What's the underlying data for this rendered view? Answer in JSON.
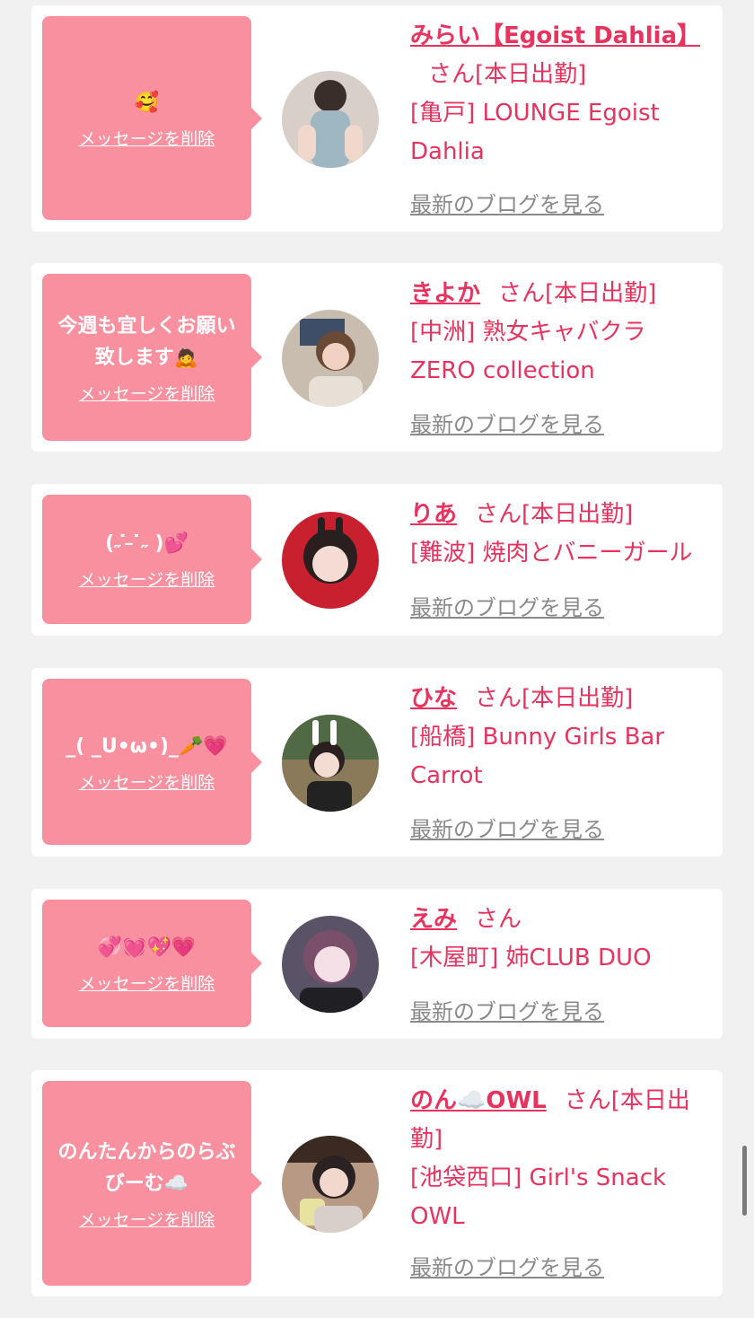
{
  "entries": [
    {
      "message": "🥰",
      "delete_label": "メッセージを削除",
      "name": "みらい【Egoist Dahlia】",
      "suffix": "さん[本日出勤]",
      "shop": "[亀戸] LOUNGE Egoist Dahlia",
      "blog_label": "最新のブログを見る"
    },
    {
      "message": "今週も宜しくお願い致します🙇",
      "delete_label": "メッセージを削除",
      "name": "きよか",
      "suffix": "さん[本日出勤]",
      "shop": "[中洲] 熟女キャバクラ ZERO collection",
      "blog_label": "最新のブログを見る"
    },
    {
      "message": "(˶ ̇ ̵ ̇˶ )💕",
      "delete_label": "メッセージを削除",
      "name": "りあ",
      "suffix": "さん[本日出勤]",
      "shop": "[難波] 焼肉とバニーガール",
      "blog_label": "最新のブログを見る"
    },
    {
      "message": "_( _U•ω•)_🥕💗",
      "delete_label": "メッセージを削除",
      "name": "ひな",
      "suffix": "さん[本日出勤]",
      "shop": "[船橋] Bunny Girls Bar Carrot",
      "blog_label": "最新のブログを見る"
    },
    {
      "message": "💞💓💖💗",
      "delete_label": "メッセージを削除",
      "name": "えみ",
      "suffix": "さん",
      "shop": "[木屋町] 姉CLUB DUO",
      "blog_label": "最新のブログを見る"
    },
    {
      "message": "のんたんからのらぶびーむ☁️",
      "delete_label": "メッセージを削除",
      "name": "のん☁️OWL",
      "suffix": "さん[本日出勤]",
      "shop": "[池袋西口] Girl's Snack OWL",
      "blog_label": "最新のブログを見る"
    }
  ],
  "avatar_icon": "profile-photo"
}
